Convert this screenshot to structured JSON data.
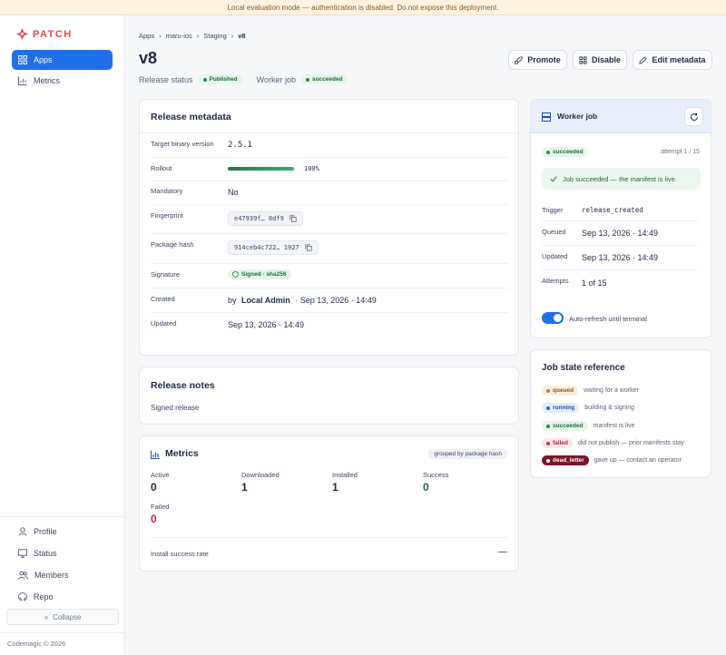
{
  "banner": "Local evaluation mode — authentication is disabled. Do not expose this deployment.",
  "brand": {
    "name": "PATCH",
    "color": "#e5484d"
  },
  "sidebar": {
    "top": [
      {
        "label": "Apps",
        "icon": "apps-icon",
        "active": true
      },
      {
        "label": "Metrics",
        "icon": "metrics-icon",
        "active": false
      }
    ],
    "bottom": [
      {
        "label": "Profile",
        "icon": "profile-icon"
      },
      {
        "label": "Status",
        "icon": "status-icon"
      },
      {
        "label": "Members",
        "icon": "members-icon"
      },
      {
        "label": "Repo",
        "icon": "repo-icon"
      }
    ],
    "collapse_label": "Collapse",
    "copyright": "Codemagic © 2026"
  },
  "breadcrumb": [
    "Apps",
    "maru-ios",
    "Staging",
    "v8"
  ],
  "title": "v8",
  "status": {
    "release_label": "Release status",
    "release_badge": "Published",
    "job_label": "Worker job",
    "job_badge": "succeeded"
  },
  "actions": {
    "promote": "Promote",
    "disable": "Disable",
    "edit": "Edit metadata"
  },
  "metadata": {
    "title": "Release metadata",
    "target_binary_label": "Target binary version",
    "target_binary_value": "2.5.1",
    "rollout_label": "Rollout",
    "rollout_value": "100%",
    "rollout_fraction": 1.0,
    "mandatory_label": "Mandatory",
    "mandatory_value": "No",
    "fingerprint_label": "Fingerprint",
    "fingerprint_value": "e47939f… 8df9",
    "package_hash_label": "Package hash",
    "package_hash_value": "914ceb4c722… 1927",
    "signature_label": "Signature",
    "signature_value": "Signed · sha256",
    "created_label": "Created",
    "created_by": "by",
    "created_user": "Local Admin",
    "created_date": "· Sep 13, 2026 · 14:49",
    "updated_label": "Updated",
    "updated_value": "Sep 13, 2026 · 14:49"
  },
  "notes": {
    "title": "Release notes",
    "text": "Signed release"
  },
  "metrics": {
    "title": "Metrics",
    "group_badge": "grouped by package hash",
    "items": [
      {
        "label": "Active",
        "value": "0"
      },
      {
        "label": "Downloaded",
        "value": "1"
      },
      {
        "label": "Installed",
        "value": "1"
      },
      {
        "label": "Success",
        "value": "0"
      },
      {
        "label": "Failed",
        "value": "0"
      }
    ],
    "install_rate_label": "Install success rate",
    "install_rate_value": "—"
  },
  "worker_job": {
    "title": "Worker job",
    "badge": "succeeded",
    "attempt": "attempt 1 / 15",
    "message": "Job succeeded — the manifest is live.",
    "trigger_label": "Trigger",
    "trigger_value": "release_created",
    "queued_label": "Queued",
    "queued_value": "Sep 13, 2026 · 14:49",
    "updated_label": "Updated",
    "updated_value": "Sep 13, 2026 · 14:49",
    "attempts_label": "Attempts",
    "attempts_value": "1 of 15",
    "auto_refresh_label": "Auto-refresh until terminal",
    "auto_refresh_on": true
  },
  "job_states": {
    "title": "Job state reference",
    "items": [
      {
        "state": "queued",
        "desc": "waiting for a worker"
      },
      {
        "state": "running",
        "desc": "building & signing"
      },
      {
        "state": "succeeded",
        "desc": "manifest is live"
      },
      {
        "state": "failed",
        "desc": "did not publish — prior manifests stay"
      },
      {
        "state": "dead_letter",
        "desc": "gave up — contact an operator"
      }
    ]
  }
}
